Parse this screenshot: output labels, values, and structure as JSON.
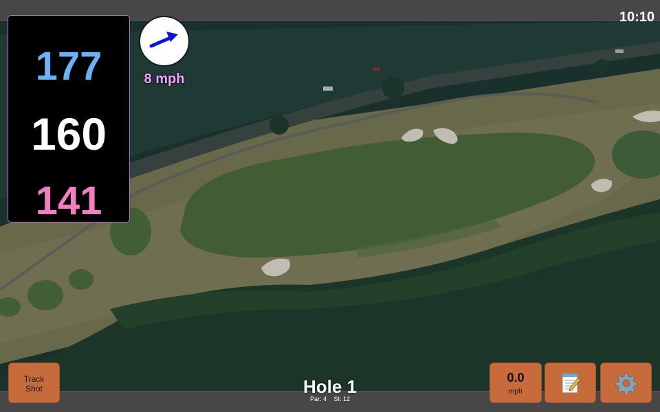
{
  "status_bar": {
    "time": "10:10"
  },
  "distances": {
    "back": "177",
    "middle": "160",
    "front": "141"
  },
  "wind": {
    "speed": "8 mph",
    "direction_icon": "arrow-east-northeast-icon"
  },
  "hole": {
    "title": "Hole 1",
    "par": "Par: 4",
    "stroke_index": "SI: 12"
  },
  "buttons": {
    "track_shot_line1": "Track",
    "track_shot_line2": "Shot",
    "speed_value": "0.0",
    "speed_unit": "mph",
    "notes_icon": "notepad-icon",
    "settings_icon": "gear-icon"
  },
  "colors": {
    "back_distance": "#6faff3",
    "middle_distance": "#ffffff",
    "front_distance": "#f07fc2",
    "wind_text": "#f0a4ff",
    "button": "#c86b3c",
    "bars": "#474747",
    "accent_border": "#b26bd1"
  }
}
